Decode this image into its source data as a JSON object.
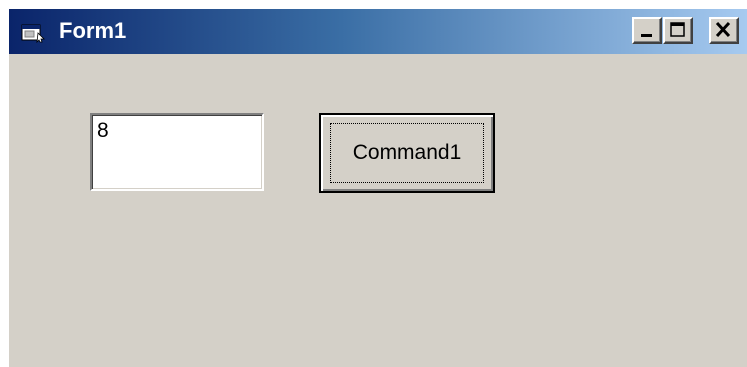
{
  "window": {
    "title": "Form1",
    "icon": "form-app-icon",
    "titlebar_colors": [
      "#0a246a",
      "#a6caf0"
    ],
    "face_color": "#d4d0c8"
  },
  "caption_buttons": {
    "minimize_icon": "minimize-icon",
    "maximize_icon": "maximize-icon",
    "close_icon": "close-icon"
  },
  "textbox": {
    "value": "8"
  },
  "command_button": {
    "label": "Command1"
  }
}
